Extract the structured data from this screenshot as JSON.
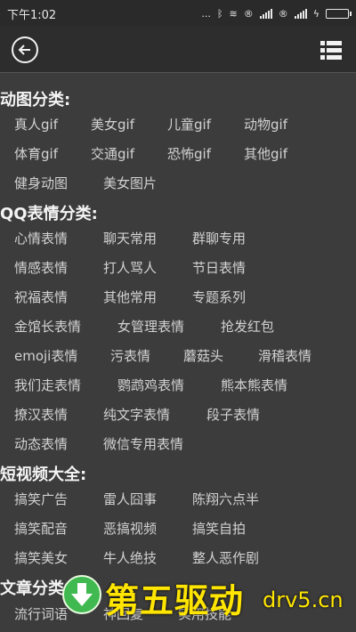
{
  "status": {
    "time": "下午1:02",
    "dots": "...",
    "badge1": "®",
    "badge2": "®"
  },
  "appbar": {
    "back_icon": "back-arrow-icon",
    "menu_icon": "list-menu-icon"
  },
  "categories": [
    {
      "title": "动图分类:",
      "items": [
        "真人gif",
        "美女gif",
        "儿童gif",
        "动物gif",
        "体育gif",
        "交通gif",
        "恐怖gif",
        "其他gif",
        "健身动图",
        "美女图片"
      ]
    },
    {
      "title": "QQ表情分类:",
      "items": [
        "心情表情",
        "聊天常用",
        "群聊专用",
        "情感表情",
        "打人骂人",
        "节日表情",
        "祝福表情",
        "其他常用",
        "专题系列",
        "金馆长表情",
        "女管理表情",
        "抢发红包",
        "emoji表情",
        "污表情",
        "蘑菇头",
        "滑稽表情",
        "我们走表情",
        "鹦鹉鸡表情",
        "熊本熊表情",
        "撩汉表情",
        "纯文字表情",
        "段子表情",
        "动态表情",
        "微信专用表情"
      ]
    },
    {
      "title": "短视频大全:",
      "items": [
        "搞笑广告",
        "雷人囧事",
        "陈翔六点半",
        "搞笑配音",
        "恶搞视频",
        "搞笑自拍",
        "搞笑美女",
        "牛人绝技",
        "整人恶作剧"
      ]
    },
    {
      "title": "文章分类",
      "items": [
        "流行词语",
        "神回复",
        "实用技能"
      ]
    }
  ],
  "watermark": {
    "title": "第五驱动",
    "site": "drv5.cn"
  },
  "colors": {
    "background": "#3c3c3c",
    "appbar": "#2d2d2d",
    "watermark": "#ffe500",
    "battery": "#5fd35f"
  }
}
